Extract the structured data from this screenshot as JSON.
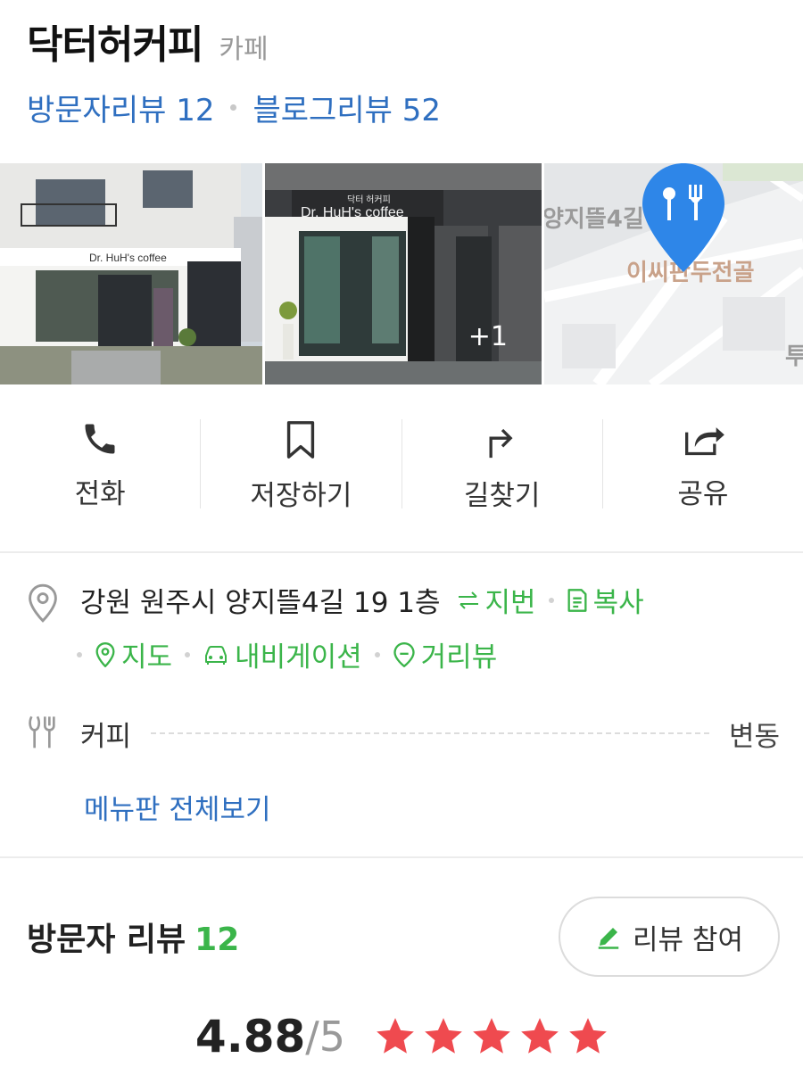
{
  "place": {
    "name": "닥터허커피",
    "category": "카페",
    "visitor_reviews_label": "방문자리뷰 12",
    "blog_reviews_label": "블로그리뷰 52"
  },
  "gallery": {
    "photo1_sign": "Dr. HuH's coffee",
    "photo2_sign": "Dr. HuH's coffee",
    "photo2_sign_top": "닥터 허커피",
    "more_count": "+1",
    "map_street": "양지뜰4길",
    "map_place": "이씨판두전골",
    "map_edge": "투"
  },
  "actions": [
    {
      "label": "전화",
      "icon": "phone-icon"
    },
    {
      "label": "저장하기",
      "icon": "bookmark-icon"
    },
    {
      "label": "길찾기",
      "icon": "directions-icon"
    },
    {
      "label": "공유",
      "icon": "share-icon"
    }
  ],
  "info": {
    "address": "강원 원주시 양지뜰4길 19 1층",
    "jibun_label": "지번",
    "copy_label": "복사",
    "map_label": "지도",
    "navigation_label": "내비게이션",
    "streetview_label": "거리뷰",
    "menu_item": "커피",
    "menu_price": "변동",
    "menu_all_link": "메뉴판 전체보기"
  },
  "reviews": {
    "title": "방문자 리뷰",
    "count": "12",
    "write_button": "리뷰 참여",
    "score": "4.88",
    "score_max": "/5",
    "stars": 5
  },
  "colors": {
    "link_blue": "#2f6fc0",
    "green": "#3bb54a",
    "star_red": "#ef4a4f",
    "map_pin": "#2e86e8"
  }
}
